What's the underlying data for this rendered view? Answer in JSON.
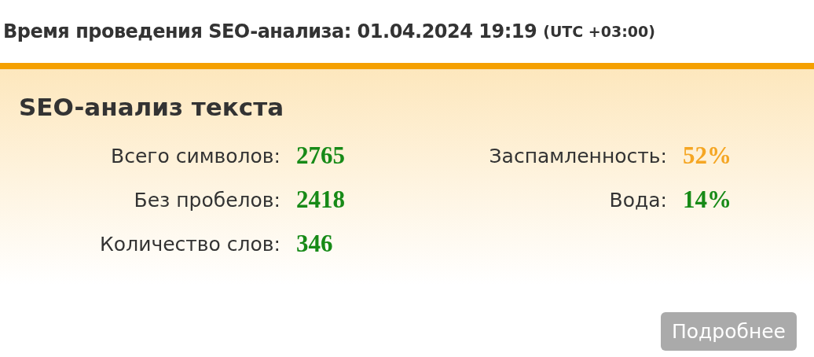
{
  "header": {
    "title": "Время проведения SEO-анализа: 01.04.2024 19:19",
    "timezone": "(UTC +03:00)"
  },
  "panel": {
    "title": "SEO-анализ текста",
    "left_stats": [
      {
        "label": "Всего символов:",
        "value": "2765",
        "color": "#178a17"
      },
      {
        "label": "Без пробелов:",
        "value": "2418",
        "color": "#178a17"
      },
      {
        "label": "Количество слов:",
        "value": "346",
        "color": "#178a17"
      }
    ],
    "right_stats": [
      {
        "label": "Заспамленность:",
        "value": "52%",
        "color": "#f5a623"
      },
      {
        "label": "Вода:",
        "value": "14%",
        "color": "#178a17"
      }
    ],
    "button": "Подробнее"
  }
}
